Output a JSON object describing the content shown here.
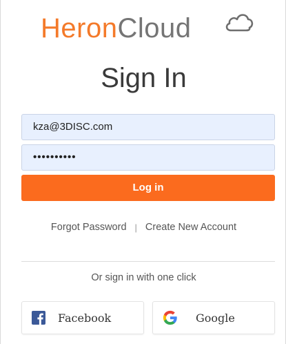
{
  "logo": {
    "part1": "Heron",
    "part2": "Cloud",
    "icon": "cloud-icon"
  },
  "title": "Sign In",
  "form": {
    "email_value": "kza@3DISC.com",
    "password_value": "••••••••••",
    "login_label": "Log in"
  },
  "links": {
    "forgot": "Forgot Password",
    "separator": "|",
    "create": "Create New Account"
  },
  "social": {
    "prompt": "Or sign in with one click",
    "facebook_label": "Facebook",
    "google_label": "Google"
  },
  "colors": {
    "brand_orange": "#f47a2a",
    "button_orange": "#fb6b1e",
    "input_bg": "#e8f0fe",
    "facebook_blue": "#3b5998"
  }
}
